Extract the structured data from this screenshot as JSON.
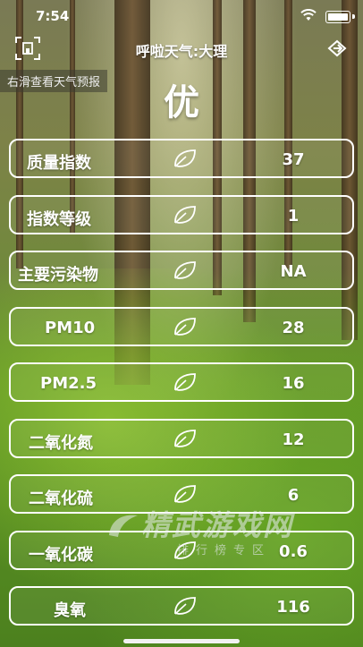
{
  "status_bar": {
    "time": "7:54"
  },
  "nav": {
    "title": "呼啦天气:大理"
  },
  "hint": {
    "text": "右滑查看天气预报"
  },
  "aqi_level": "优",
  "rows": [
    {
      "label": "质量指数",
      "value": "37"
    },
    {
      "label": "指数等级",
      "value": "1"
    },
    {
      "label": "主要污染物",
      "value": "NA"
    },
    {
      "label": "PM10",
      "value": "28"
    },
    {
      "label": "PM2.5",
      "value": "16"
    },
    {
      "label": "二氧化氮",
      "value": "12"
    },
    {
      "label": "二氧化硫",
      "value": "6"
    },
    {
      "label": "一氧化碳",
      "value": "0.6"
    },
    {
      "label": "臭氧",
      "value": "116"
    }
  ],
  "watermark": {
    "main": "精武游戏网",
    "sub": "排行榜专区"
  },
  "icons": {
    "leaf": "leaf-icon",
    "left": "scan-icon",
    "right": "share-icon"
  }
}
